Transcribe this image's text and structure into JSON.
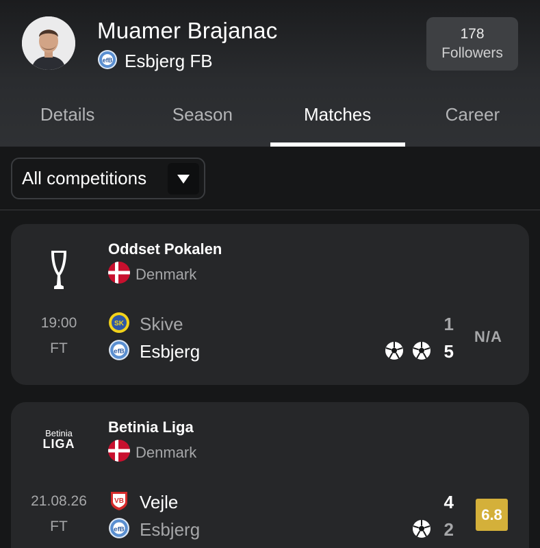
{
  "player": {
    "name": "Muamer Brajanac",
    "team": "Esbjerg FB",
    "followers_count": "178",
    "followers_label": "Followers"
  },
  "tabs": [
    {
      "label": "Details",
      "active": false
    },
    {
      "label": "Season",
      "active": false
    },
    {
      "label": "Matches",
      "active": true
    },
    {
      "label": "Career",
      "active": false
    }
  ],
  "filter": {
    "selected": "All competitions"
  },
  "matches": [
    {
      "competition": "Oddset Pokalen",
      "country": "Denmark",
      "time": "19:00",
      "status": "FT",
      "home": {
        "name": "Skive",
        "score": "1",
        "goals": 0,
        "bold": false
      },
      "away": {
        "name": "Esbjerg",
        "score": "5",
        "goals": 2,
        "bold": true
      },
      "rating": "N/A"
    },
    {
      "competition": "Betinia Liga",
      "competition_logo_text": [
        "Betinia",
        "LIGA"
      ],
      "country": "Denmark",
      "time": "21.08.26",
      "status": "FT",
      "home": {
        "name": "Vejle",
        "score": "4",
        "goals": 0,
        "bold": true
      },
      "away": {
        "name": "Esbjerg",
        "score": "2",
        "goals": 1,
        "bold": false
      },
      "rating": "6.8",
      "rating_color": "#d4b03a"
    }
  ],
  "icons": {
    "team_badge": "esbjerg-badge-icon",
    "flag": "denmark-flag-icon",
    "goal": "soccer-ball-icon",
    "dropdown": "triangle-down-icon"
  }
}
